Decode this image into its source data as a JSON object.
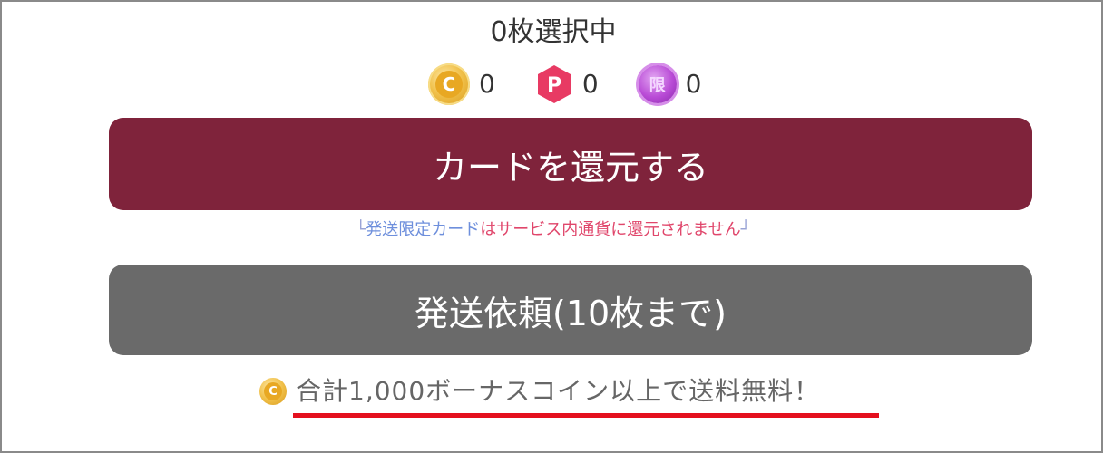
{
  "selection": {
    "count_text": "0枚選択中"
  },
  "currencies": [
    {
      "icon": "bonus-coin-icon",
      "value": "0"
    },
    {
      "icon": "point-icon",
      "value": "0"
    },
    {
      "icon": "limited-coin-icon",
      "value": "0"
    }
  ],
  "icons": {
    "coin_letter": "C",
    "point_letter": "P",
    "limited_letter": "限"
  },
  "return_button": {
    "label": "カードを還元する",
    "color": "#7f233b"
  },
  "return_note": {
    "open_bracket": "└",
    "limited_card": "発送限定カード",
    "rest": "はサービス内通貨に還元されません",
    "close_bracket": "┘"
  },
  "ship_button": {
    "label": "発送依頼(10枚まで)",
    "color": "#6a6a6a"
  },
  "shipping_notice": {
    "text": "合計1,000ボーナスコイン以上で送料無料！",
    "underline_color": "#e4101e"
  }
}
